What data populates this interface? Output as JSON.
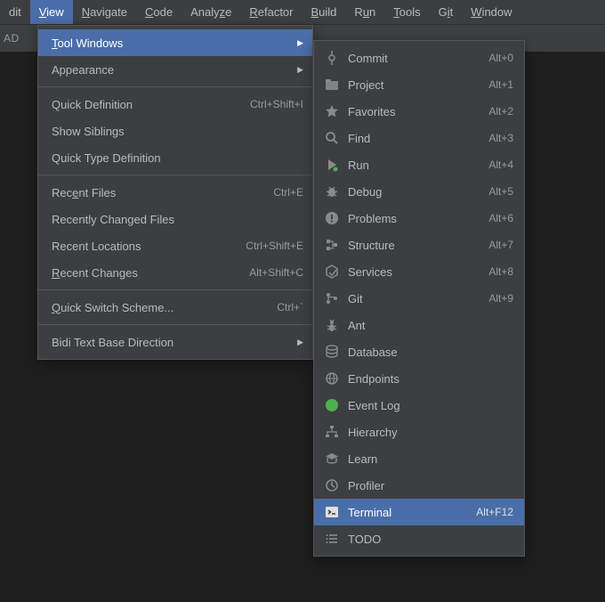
{
  "menubar": {
    "items": [
      {
        "label": "dit",
        "underline_rest": "",
        "pre": ""
      },
      {
        "label": "View",
        "u": "V",
        "rest": "iew",
        "selected": true
      },
      {
        "label": "Navigate",
        "u": "N",
        "rest": "avigate"
      },
      {
        "label": "Code",
        "u": "C",
        "rest": "ode"
      },
      {
        "label": "Analyze",
        "u": "",
        "pre": "Analy",
        "mid": "z",
        "rest": "e"
      },
      {
        "label": "Refactor",
        "u": "R",
        "rest": "efactor"
      },
      {
        "label": "Build",
        "u": "B",
        "rest": "uild"
      },
      {
        "label": "Run",
        "u": "",
        "pre": "R",
        "mid": "u",
        "rest": "n"
      },
      {
        "label": "Tools",
        "u": "T",
        "rest": "ools"
      },
      {
        "label": "Git",
        "u": "",
        "pre": "G",
        "mid": "i",
        "rest": "t"
      },
      {
        "label": "Window",
        "u": "W",
        "rest": "indow"
      }
    ]
  },
  "toolbar_text": "AD",
  "view_menu": [
    {
      "type": "item",
      "u": "T",
      "label": "ool Windows",
      "has_sub": true,
      "highlighted": true
    },
    {
      "type": "item",
      "u": "",
      "label": "Appearance",
      "has_sub": true
    },
    {
      "type": "sep"
    },
    {
      "type": "item",
      "label": "Quick Definition",
      "shortcut": "Ctrl+Shift+I"
    },
    {
      "type": "item",
      "label": "Show Siblings"
    },
    {
      "type": "item",
      "label": "Quick Type Definition"
    },
    {
      "type": "sep"
    },
    {
      "type": "item",
      "label": "Recent Files",
      "u_in": "e",
      "pre": "Rec",
      "rest": "nt Files",
      "shortcut": "Ctrl+E"
    },
    {
      "type": "item",
      "label": "Recently Changed Files"
    },
    {
      "type": "item",
      "label": "Recent Locations",
      "shortcut": "Ctrl+Shift+E"
    },
    {
      "type": "item",
      "u": "R",
      "label": "ecent Changes",
      "shortcut": "Alt+Shift+C"
    },
    {
      "type": "sep"
    },
    {
      "type": "item",
      "u": "Q",
      "label": "uick Switch Scheme...",
      "shortcut": "Ctrl+`"
    },
    {
      "type": "sep"
    },
    {
      "type": "item",
      "label": "Bidi Text Base Direction",
      "has_sub": true
    }
  ],
  "tool_windows": [
    {
      "icon": "commit",
      "label": "Commit",
      "shortcut": "Alt+0"
    },
    {
      "icon": "project",
      "label": "Project",
      "shortcut": "Alt+1"
    },
    {
      "icon": "favorites",
      "label": "Favorites",
      "shortcut": "Alt+2"
    },
    {
      "icon": "find",
      "label": "Find",
      "shortcut": "Alt+3"
    },
    {
      "icon": "run",
      "label": "Run",
      "shortcut": "Alt+4"
    },
    {
      "icon": "debug",
      "label": "Debug",
      "shortcut": "Alt+5"
    },
    {
      "icon": "problems",
      "label": "Problems",
      "shortcut": "Alt+6"
    },
    {
      "icon": "structure",
      "label": "Structure",
      "shortcut": "Alt+7"
    },
    {
      "icon": "services",
      "label": "Services",
      "shortcut": "Alt+8"
    },
    {
      "icon": "git",
      "label": "Git",
      "shortcut": "Alt+9"
    },
    {
      "icon": "ant",
      "label": "Ant"
    },
    {
      "icon": "database",
      "label": "Database"
    },
    {
      "icon": "endpoints",
      "label": "Endpoints"
    },
    {
      "icon": "eventlog",
      "label": "Event Log"
    },
    {
      "icon": "hierarchy",
      "label": "Hierarchy"
    },
    {
      "icon": "learn",
      "label": "Learn"
    },
    {
      "icon": "profiler",
      "label": "Profiler"
    },
    {
      "icon": "terminal",
      "label": "Terminal",
      "shortcut": "Alt+F12",
      "highlighted": true
    },
    {
      "icon": "todo",
      "label": "TODO"
    }
  ]
}
